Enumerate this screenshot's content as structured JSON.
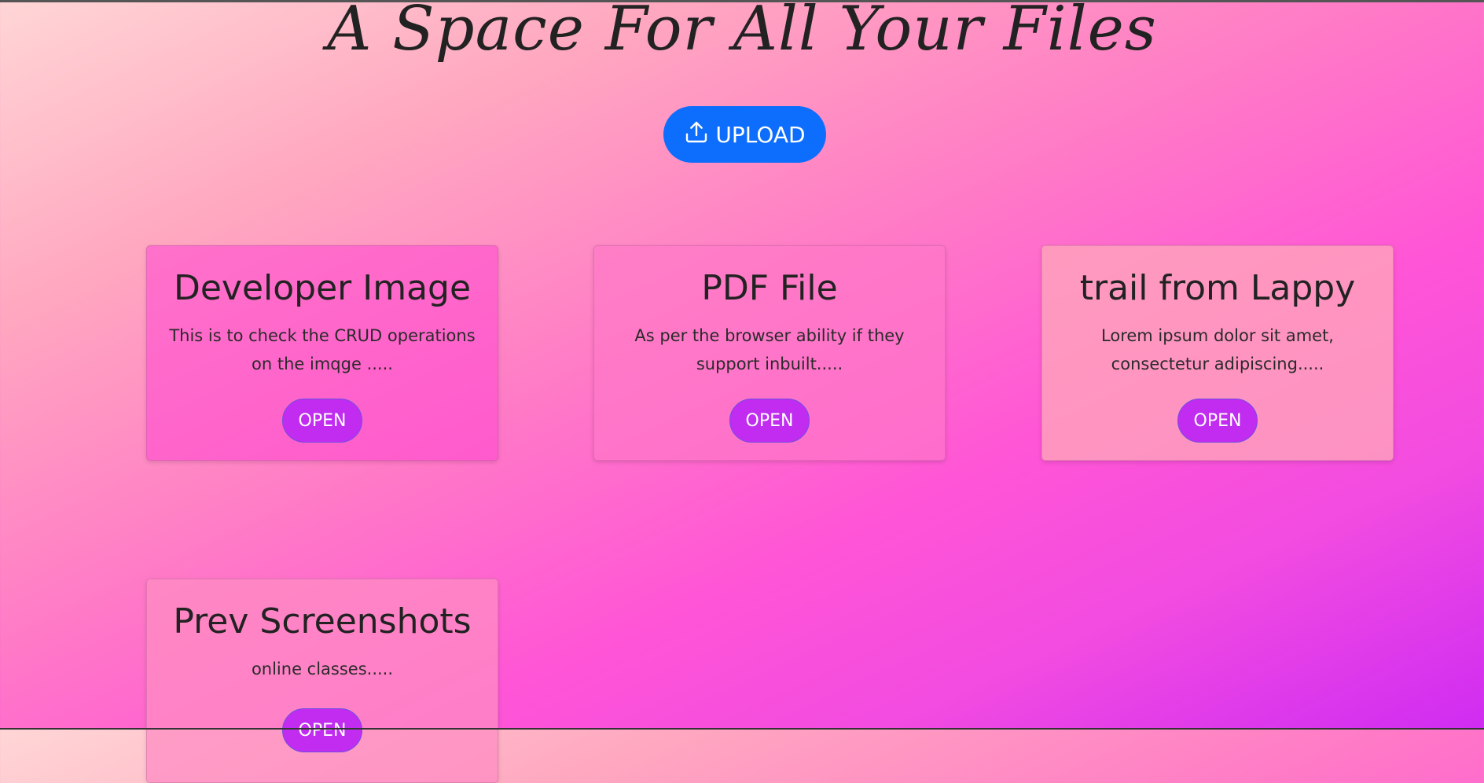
{
  "header": {
    "title": "A Space For All Your Files"
  },
  "upload": {
    "label": "UPLOAD",
    "icon": "upload-icon",
    "color": "#0d6efd"
  },
  "cards": [
    {
      "title": "Developer Image",
      "description": "This is to check the CRUD operations on the imqge .....",
      "button": "OPEN"
    },
    {
      "title": "PDF File",
      "description": "As per the browser ability if they support inbuilt.....",
      "button": "OPEN"
    },
    {
      "title": "trail from Lappy",
      "description": "Lorem ipsum dolor sit amet, consectetur adipiscing.....",
      "button": "OPEN"
    },
    {
      "title": "Prev Screenshots",
      "description": "online classes.....",
      "button": "OPEN"
    }
  ],
  "colors": {
    "open_button": "#c12cf0",
    "background_start": "#ffd6d6",
    "background_end": "#cf2cf2"
  }
}
